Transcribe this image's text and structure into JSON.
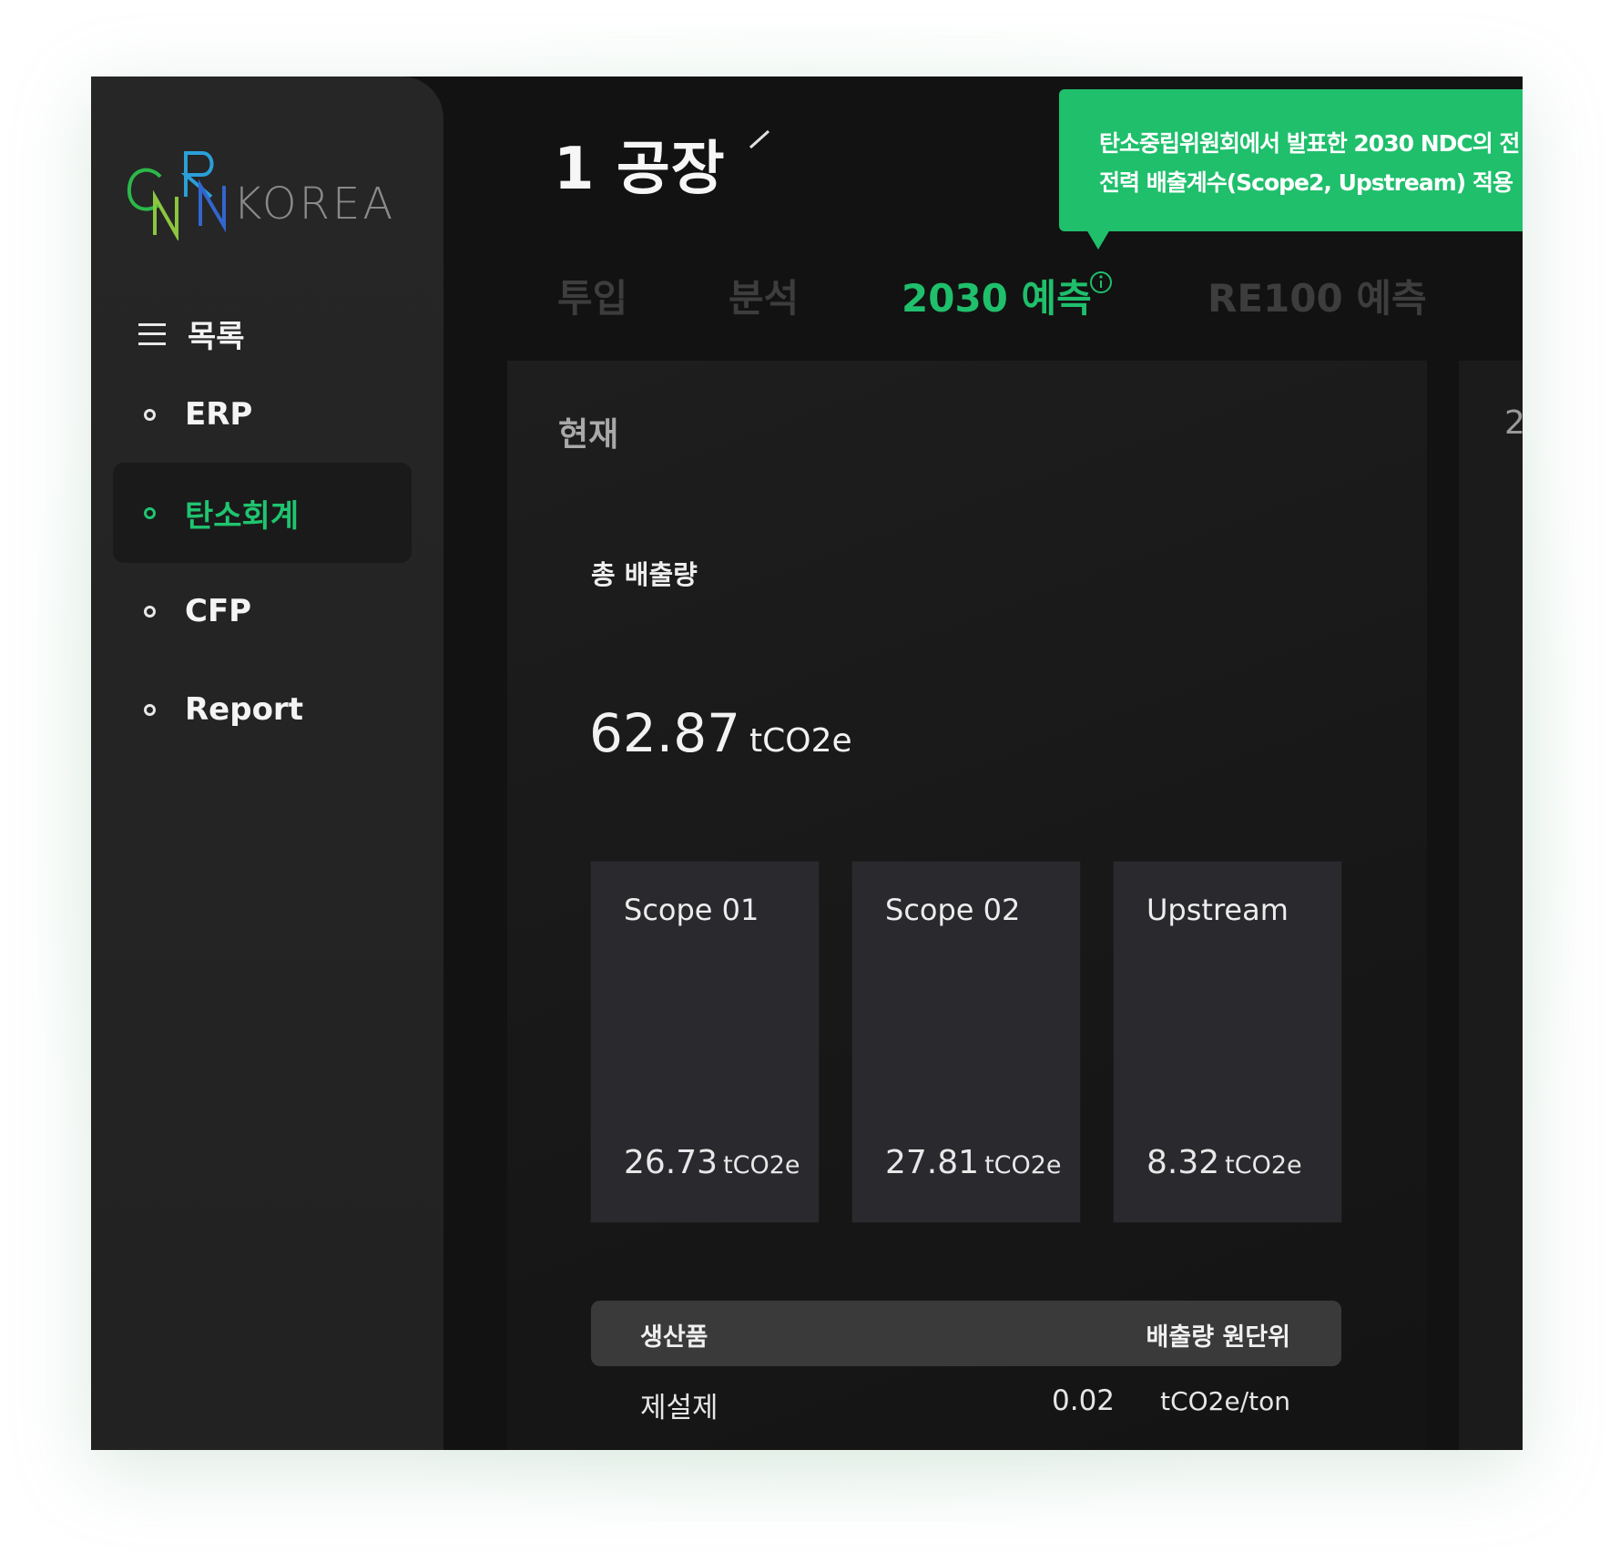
{
  "brand": {
    "logo_text": "CNR KOREA",
    "logo_suffix": "KOREA",
    "colors": {
      "c": "#2bb84a",
      "n": "#8cc63f",
      "r": "#2a9fd8",
      "r2": "#3366cc"
    }
  },
  "sidebar": {
    "menu_label": "목록",
    "items": [
      {
        "label": "ERP",
        "active": false
      },
      {
        "label": "탄소회계",
        "active": true
      },
      {
        "label": "CFP",
        "active": false
      },
      {
        "label": "Report",
        "active": false
      }
    ]
  },
  "header": {
    "title": "1 공장",
    "tooltip": "탄소중립위원회에서 발표한 2030 NDC의 전\n전력 배출계수(Scope2, Upstream) 적용"
  },
  "tabs": [
    {
      "label": "투입",
      "active": false
    },
    {
      "label": "분석",
      "active": false
    },
    {
      "label": "2030 예측",
      "active": true
    },
    {
      "label": "RE100 예측",
      "active": false
    }
  ],
  "panel": {
    "section_label": "현재",
    "next_panel_fragment": "2",
    "total_label": "총 배출량",
    "total_value": "62.87",
    "total_unit": "tCO2e",
    "cards": [
      {
        "title": "Scope 01",
        "value": "26.73",
        "unit": "tCO2e"
      },
      {
        "title": "Scope 02",
        "value": "27.81",
        "unit": "tCO2e"
      },
      {
        "title": "Upstream",
        "value": "8.32",
        "unit": "tCO2e"
      }
    ],
    "table": {
      "col_product": "생산품",
      "col_intensity": "배출량 원단위",
      "rows": [
        {
          "product": "제설제",
          "value": "0.02",
          "unit": "tCO2e/ton"
        }
      ]
    }
  },
  "theme": {
    "accent": "#1fbf6c",
    "bg": "#121212",
    "sidebar": "#242424"
  }
}
